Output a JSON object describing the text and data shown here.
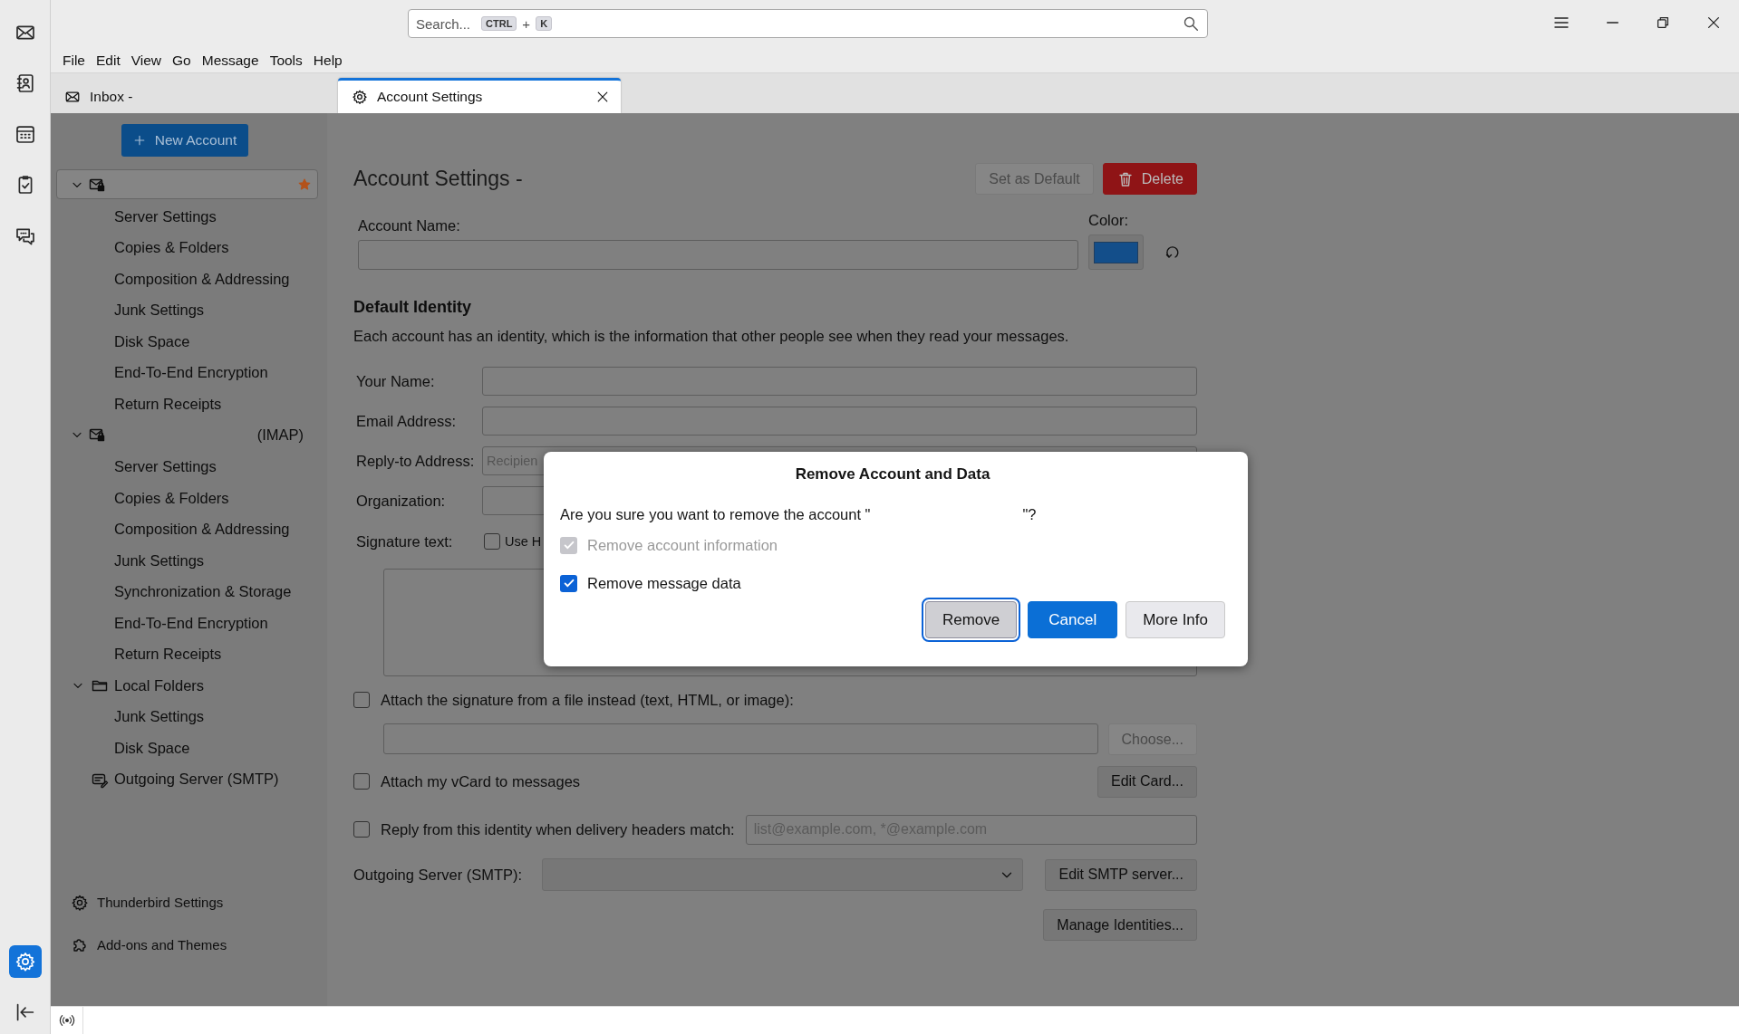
{
  "spaces": [
    {
      "kind": "mail",
      "selected": false
    },
    {
      "kind": "addressbook",
      "selected": false
    },
    {
      "kind": "calendar",
      "selected": false
    },
    {
      "kind": "tasks",
      "selected": false
    },
    {
      "kind": "chat",
      "selected": false
    }
  ],
  "spaces_bottom": [
    {
      "kind": "settings",
      "selected": true
    }
  ],
  "search": {
    "placeholder": "Search...",
    "keys": [
      "CTRL",
      "K"
    ],
    "joiner": "+"
  },
  "menu": [
    "File",
    "Edit",
    "View",
    "Go",
    "Message",
    "Tools",
    "Help"
  ],
  "tabs": [
    {
      "kind": "mail",
      "label": "Inbox -",
      "selected": false,
      "closable": false
    },
    {
      "kind": "settings",
      "label": "Account Settings",
      "selected": true,
      "closable": true
    }
  ],
  "new_account_button": "New Account",
  "account_tree": [
    {
      "kind": "account",
      "expanded": true,
      "selected": true,
      "default": true,
      "children": [
        {
          "label": "Server Settings",
          "selected": false
        },
        {
          "label": "Copies & Folders",
          "selected": false
        },
        {
          "label": "Composition & Addressing",
          "selected": false
        },
        {
          "label": "Junk Settings",
          "selected": false
        },
        {
          "label": "Disk Space",
          "selected": false
        },
        {
          "label": "End-To-End Encryption",
          "selected": false
        },
        {
          "label": "Return Receipts",
          "selected": false
        }
      ]
    },
    {
      "kind": "account",
      "suffix": "(IMAP)",
      "expanded": true,
      "selected": false,
      "default": false,
      "children": [
        {
          "label": "Server Settings",
          "selected": false
        },
        {
          "label": "Copies & Folders",
          "selected": false
        },
        {
          "label": "Composition & Addressing",
          "selected": false
        },
        {
          "label": "Junk Settings",
          "selected": false
        },
        {
          "label": "Synchronization & Storage",
          "selected": false
        },
        {
          "label": "End-To-End Encryption",
          "selected": false
        },
        {
          "label": "Return Receipts",
          "selected": false
        }
      ]
    },
    {
      "kind": "folder",
      "label": "Local Folders",
      "expanded": true,
      "selected": false,
      "default": false,
      "children": [
        {
          "label": "Junk Settings",
          "selected": false
        },
        {
          "label": "Disk Space",
          "selected": false
        }
      ]
    },
    {
      "kind": "smtp",
      "label": "Outgoing Server (SMTP)",
      "selected": false,
      "default": false
    }
  ],
  "sidebar_footer": [
    {
      "kind": "settings",
      "label": "Thunderbird Settings"
    },
    {
      "kind": "addons",
      "label": "Add-ons and Themes"
    }
  ],
  "page": {
    "title": "Account Settings -",
    "set_default_button": {
      "label": "Set as Default",
      "disabled": true
    },
    "delete_button": {
      "label": "Delete",
      "disabled": false
    },
    "account_name_label": "Account Name:",
    "color_label": "Color:",
    "identity_heading": "Default Identity",
    "identity_description": "Each account has an identity, which is the information that other people see when they read your messages.",
    "fields": [
      {
        "label": "Your Name:"
      },
      {
        "label": "Email Address:"
      },
      {
        "label": "Reply-to Address:",
        "placeholder": "Recipien"
      },
      {
        "label": "Organization:"
      }
    ],
    "signature_label": "Signature text:",
    "use_html": {
      "label": "Use H",
      "checked": false
    },
    "attach_signature": {
      "label": "Attach the signature from a file instead (text, HTML, or image):",
      "checked": false
    },
    "choose_button": {
      "label": "Choose...",
      "disabled": true
    },
    "attach_vcard": {
      "label": "Attach my vCard to messages",
      "checked": false
    },
    "edit_card_button": "Edit Card...",
    "reply_from": {
      "label": "Reply from this identity when delivery headers match:",
      "checked": false,
      "placeholder": "list@example.com, *@example.com"
    },
    "outgoing_label": "Outgoing Server (SMTP):",
    "edit_smtp_button": "Edit SMTP server...",
    "manage_identities_button": "Manage Identities..."
  },
  "dialog": {
    "title": "Remove Account and Data",
    "message": "Are you sure you want to remove the account \"",
    "message_end": "\"?",
    "options": [
      {
        "label": "Remove account information",
        "checked": true,
        "disabled": true
      },
      {
        "label": "Remove message data",
        "checked": true,
        "disabled": false
      }
    ],
    "buttons": [
      {
        "kind": "default",
        "label": "Remove"
      },
      {
        "kind": "primary",
        "label": "Cancel"
      },
      {
        "kind": "normal",
        "label": "More Info"
      }
    ]
  }
}
